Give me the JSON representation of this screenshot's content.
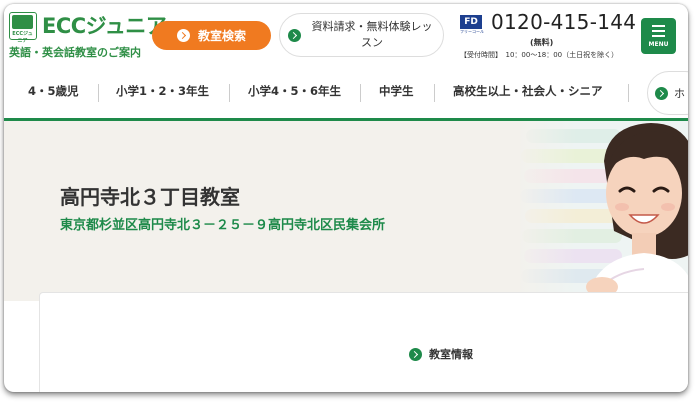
{
  "brand": {
    "logo_text": "ECCジュニア",
    "logo_box_text": "ECCジュニア",
    "tagline": "英語・英会話教室のご案内",
    "green": "#1e8a4a",
    "orange": "#f07a20"
  },
  "header": {
    "search_button": "教室検索",
    "request_button": "資料請求・無料体験レッスン",
    "phone_icon_text": "FD",
    "phone_icon_sub": "フリーコール",
    "phone_number": "0120-415-144",
    "phone_free": "(無料)",
    "phone_hours": "【受付時間】　10：00～18：00（土日祝を除く）",
    "menu_label": "MENU"
  },
  "nav": {
    "items": [
      "4・5歳児",
      "小学1・2・3年生",
      "小学4・5・6年生",
      "中学生",
      "高校生以上・社会人・シニア"
    ],
    "more_label": "ホ"
  },
  "hero": {
    "title": "高円寺北３丁目教室",
    "address": "東京都杉並区高円寺北３－２５－９高円寺北区民集会所"
  },
  "content": {
    "tab_label": "教室情報"
  }
}
